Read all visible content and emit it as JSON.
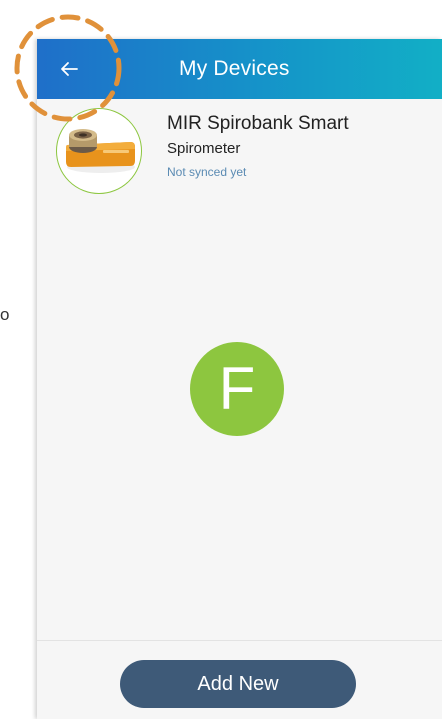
{
  "left_fragment": "o",
  "header": {
    "title": "My Devices",
    "back_icon": "arrow-left-icon"
  },
  "device": {
    "name": "MIR Spirobank Smart",
    "type": "Spirometer",
    "status": "Not synced yet"
  },
  "avatar": {
    "letter": "F",
    "color": "#8dc63f"
  },
  "footer": {
    "add_label": "Add New"
  },
  "colors": {
    "header_start": "#1f6fc9",
    "header_end": "#12afc6",
    "button": "#3e5a78",
    "highlight": "#e0913a",
    "status_text": "#5b8bb3"
  }
}
